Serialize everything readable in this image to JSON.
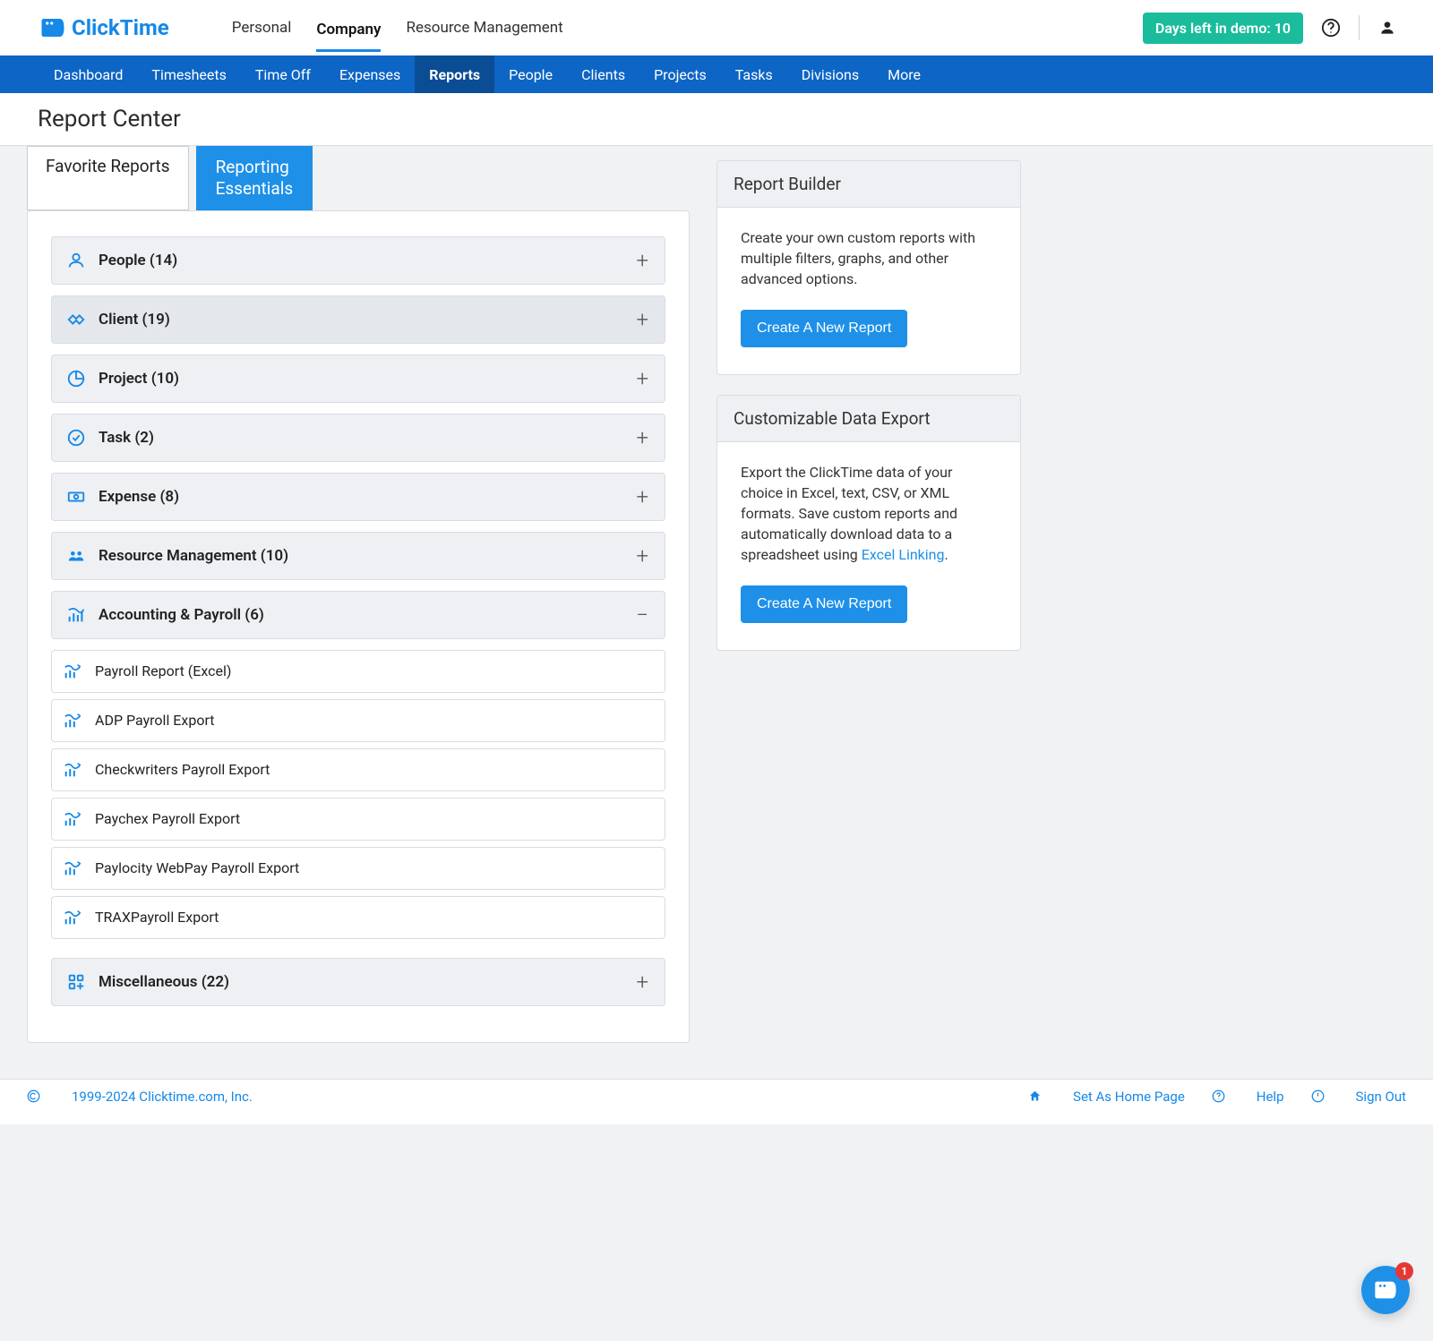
{
  "brand": "ClickTime",
  "topnav": [
    "Personal",
    "Company",
    "Resource Management"
  ],
  "topnav_active": 1,
  "demo_badge": "Days left in demo: 10",
  "bluenav": [
    "Dashboard",
    "Timesheets",
    "Time Off",
    "Expenses",
    "Reports",
    "People",
    "Clients",
    "Projects",
    "Tasks",
    "Divisions",
    "More"
  ],
  "bluenav_active": 4,
  "page_title": "Report Center",
  "tabs": [
    "Favorite Reports",
    "Reporting\nEssentials"
  ],
  "tabs_active": 1,
  "categories": [
    {
      "icon": "person",
      "label": "People (14)",
      "expanded": false,
      "hover": false
    },
    {
      "icon": "handshake",
      "label": "Client (19)",
      "expanded": false,
      "hover": true
    },
    {
      "icon": "piechart",
      "label": "Project (10)",
      "expanded": false,
      "hover": false
    },
    {
      "icon": "check",
      "label": "Task (2)",
      "expanded": false,
      "hover": false
    },
    {
      "icon": "money",
      "label": "Expense (8)",
      "expanded": false,
      "hover": false
    },
    {
      "icon": "team",
      "label": "Resource Management (10)",
      "expanded": false,
      "hover": false
    },
    {
      "icon": "barschart",
      "label": "Accounting & Payroll (6)",
      "expanded": true,
      "hover": false
    },
    {
      "icon": "grid",
      "label": "Miscellaneous (22)",
      "expanded": false,
      "hover": false
    }
  ],
  "expanded_reports": [
    "Payroll Report (Excel)",
    "ADP Payroll Export",
    "Checkwriters Payroll Export",
    "Paychex Payroll Export",
    "Paylocity WebPay Payroll Export",
    "TRAXPayroll Export"
  ],
  "builder": {
    "title": "Report Builder",
    "desc": "Create your own custom reports with multiple filters, graphs, and other advanced options.",
    "button": "Create A New Report"
  },
  "export": {
    "title": "Customizable Data Export",
    "desc_pre": "Export the ClickTime data of your choice in Excel, text, CSV, or XML formats. Save custom reports and automatically download data to a spreadsheet using ",
    "link": "Excel Linking",
    "desc_post": ".",
    "button": "Create A New Report"
  },
  "footer": {
    "copyright": "1999-2024 Clicktime.com, Inc.",
    "set_home": "Set As Home Page",
    "help": "Help",
    "signout": "Sign Out"
  },
  "chat_badge": "1"
}
